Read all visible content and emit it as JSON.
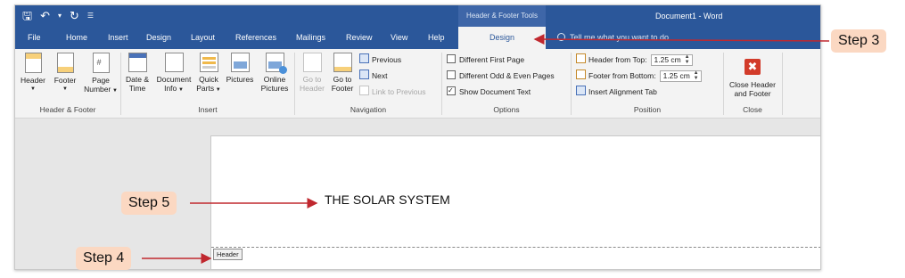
{
  "window": {
    "context_tab_title": "Header & Footer Tools",
    "document_title": "Document1 - Word"
  },
  "quick_access": {
    "icons": [
      "save-icon",
      "undo-icon",
      "redo-icon",
      "customize-icon"
    ]
  },
  "tabs": [
    {
      "label": "File"
    },
    {
      "label": "Home"
    },
    {
      "label": "Insert"
    },
    {
      "label": "Design"
    },
    {
      "label": "Layout"
    },
    {
      "label": "References"
    },
    {
      "label": "Mailings"
    },
    {
      "label": "Review"
    },
    {
      "label": "View"
    },
    {
      "label": "Help"
    },
    {
      "label": "Design",
      "active": true
    }
  ],
  "tell_me": {
    "placeholder": "Tell me what you want to do"
  },
  "ribbon": {
    "header_footer": {
      "label": "Header & Footer",
      "header_btn": "Header",
      "footer_btn": "Footer",
      "page_btn_line1": "Page",
      "page_btn_line2": "Number"
    },
    "insert": {
      "label": "Insert",
      "date_line1": "Date &",
      "date_line2": "Time",
      "docinfo_line1": "Document",
      "docinfo_line2": "Info",
      "quick_line1": "Quick",
      "quick_line2": "Parts",
      "pictures": "Pictures",
      "online_line1": "Online",
      "online_line2": "Pictures"
    },
    "navigation": {
      "label": "Navigation",
      "goto_header_line1": "Go to",
      "goto_header_line2": "Header",
      "goto_footer_line1": "Go to",
      "goto_footer_line2": "Footer",
      "previous": "Previous",
      "next": "Next",
      "link": "Link to Previous"
    },
    "options": {
      "label": "Options",
      "diff_first": "Different First Page",
      "diff_first_checked": false,
      "diff_odd_even": "Different Odd & Even Pages",
      "diff_odd_even_checked": false,
      "show_doc_text": "Show Document Text",
      "show_doc_text_checked": true
    },
    "position": {
      "label": "Position",
      "header_from_top": "Header from Top:",
      "header_value": "1.25 cm",
      "footer_from_bottom": "Footer from Bottom:",
      "footer_value": "1.25 cm",
      "alignment_tab": "Insert Alignment Tab"
    },
    "close": {
      "label": "Close",
      "btn_line1": "Close Header",
      "btn_line2": "and Footer"
    }
  },
  "document": {
    "header_text": "THE SOLAR SYSTEM",
    "header_tag": "Header"
  },
  "callouts": {
    "step3": "Step 3",
    "step4": "Step 4",
    "step5": "Step 5"
  },
  "colors": {
    "word_blue": "#2b579a",
    "callout_fill": "#fbd8c2",
    "arrow_red": "#c0282f"
  }
}
